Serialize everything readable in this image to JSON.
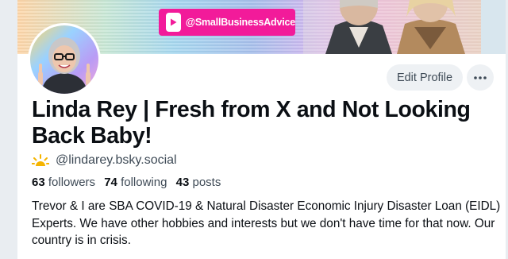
{
  "banner": {
    "youtube_handle": "@SmallBusinessAdvice"
  },
  "profile": {
    "display_name": "Linda Rey | Fresh from X and Not Looking Back Baby!",
    "handle": "@lindarey.bsky.social",
    "stats": {
      "followers_count": "63",
      "followers_label": "followers",
      "following_count": "74",
      "following_label": "following",
      "posts_count": "43",
      "posts_label": "posts"
    },
    "bio": "Trevor & I are SBA COVID-19 & Natural Disaster Economic Injury Disaster Loan (EIDL) Experts. We have other hobbies and interests but we don't have time for that now. Our country is in crisis."
  },
  "actions": {
    "edit_profile_label": "Edit Profile",
    "more_icon": "ellipsis-icon"
  },
  "icons": {
    "handle_icon": "sun-icon",
    "youtube_icon": "youtube-play-icon"
  },
  "colors": {
    "badge_pink": "#f21b9a",
    "handle_gray": "#3e4a56",
    "button_bg": "#eef1f4",
    "sun_yellow": "#f5b400"
  }
}
